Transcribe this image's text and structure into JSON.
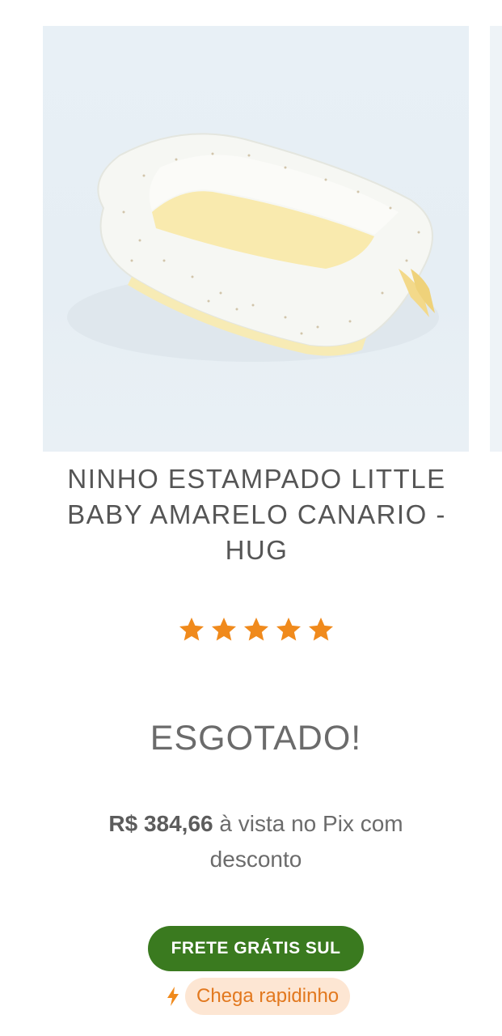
{
  "product": {
    "image_alt": "Ninho estampado amarelo",
    "title": "NINHO ESTAMPADO LITTLE BABY AMARELO CANARIO - HUG",
    "rating": 5,
    "rating_max": 5,
    "status": "ESGOTADO!",
    "pix_price": "R$ 384,66",
    "pix_text": "à vista no Pix com desconto",
    "shipping_badge": "FRETE GRÁTIS SUL",
    "delivery_label": "Chega rapidinho"
  },
  "icons": {
    "star": "star-icon",
    "bolt": "lightning-icon"
  },
  "colors": {
    "star": "#f08a1c",
    "shipping_badge_bg": "#3a7a1f",
    "delivery_pill_bg": "#fde6d3",
    "delivery_text": "#e2781e",
    "text_gray": "#555555"
  }
}
